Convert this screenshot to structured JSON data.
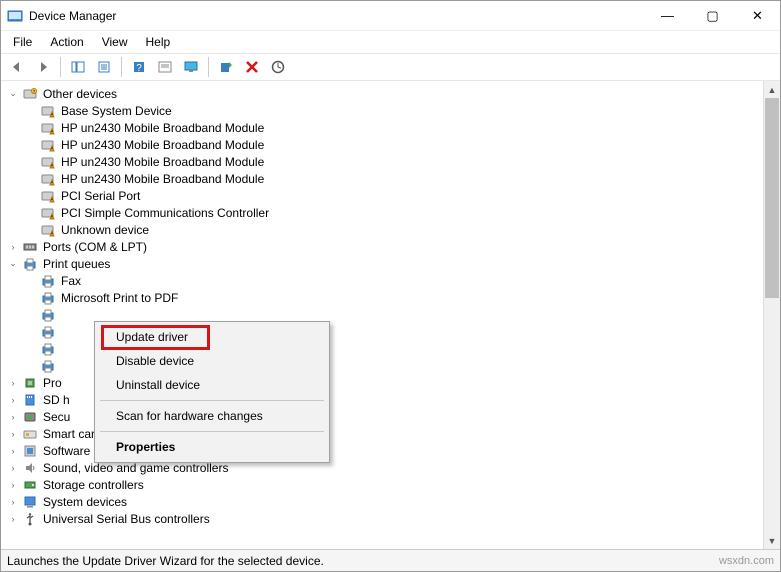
{
  "window": {
    "title": "Device Manager",
    "minimize": "—",
    "maximize": "▢",
    "close": "✕"
  },
  "menu": {
    "file": "File",
    "action": "Action",
    "view": "View",
    "help": "Help"
  },
  "toolbar": {
    "back": "Back",
    "forward": "Forward",
    "show_hide": "Show/Hide Console Tree",
    "properties": "Properties",
    "help": "Help",
    "options": "Options",
    "monitor": "Show hidden devices",
    "scan": "Scan for hardware changes",
    "uninstall": "Uninstall",
    "update": "Update driver"
  },
  "tree": {
    "other_devices": {
      "label": "Other devices",
      "items": [
        "Base System Device",
        "HP un2430 Mobile Broadband Module",
        "HP un2430 Mobile Broadband Module",
        "HP un2430 Mobile Broadband Module",
        "HP un2430 Mobile Broadband Module",
        "PCI Serial Port",
        "PCI Simple Communications Controller",
        "Unknown device"
      ]
    },
    "ports": {
      "label": "Ports (COM & LPT)"
    },
    "print_queues": {
      "label": "Print queues",
      "items": [
        "Fax",
        "Microsoft Print to PDF",
        "",
        "",
        "",
        ""
      ]
    },
    "processors": {
      "label": "Pro"
    },
    "sd_host": {
      "label": "SD h"
    },
    "security": {
      "label": "Secu"
    },
    "smart_card": {
      "label": "Smart card readers"
    },
    "software": {
      "label": "Software devices"
    },
    "sound": {
      "label": "Sound, video and game controllers"
    },
    "storage": {
      "label": "Storage controllers"
    },
    "system": {
      "label": "System devices"
    },
    "usb": {
      "label": "Universal Serial Bus controllers"
    }
  },
  "context_menu": {
    "update_driver": "Update driver",
    "disable_device": "Disable device",
    "uninstall_device": "Uninstall device",
    "scan": "Scan for hardware changes",
    "properties": "Properties"
  },
  "statusbar": {
    "text": "Launches the Update Driver Wizard for the selected device.",
    "watermark": "wsxdn.com"
  }
}
